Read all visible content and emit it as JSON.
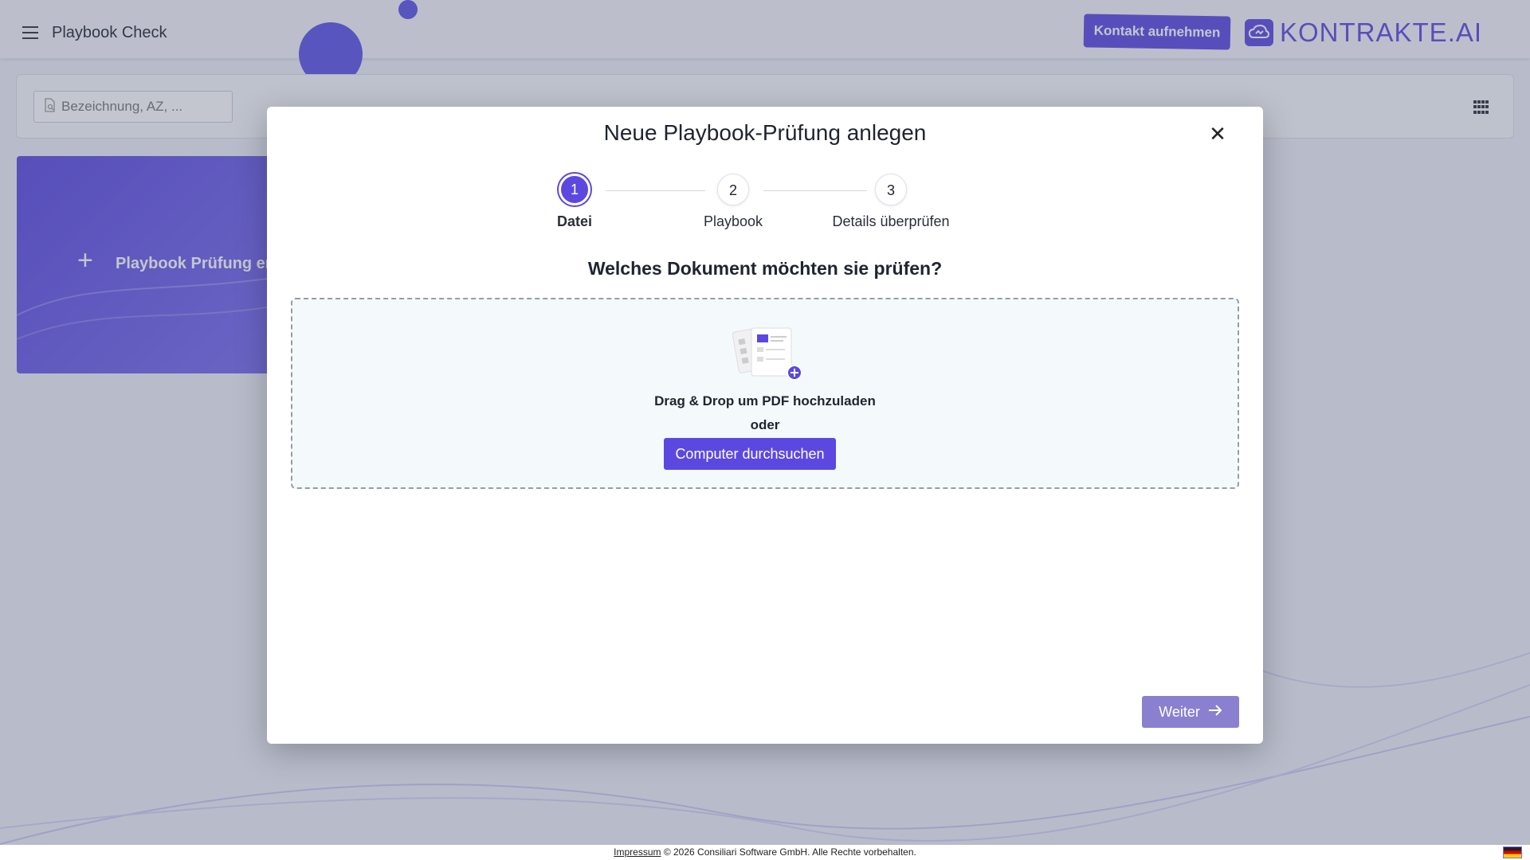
{
  "header": {
    "title": "Playbook Check",
    "contact_label": "Kontakt aufnehmen",
    "logo_text": "KONTRAKTE.AI"
  },
  "search": {
    "placeholder": "Bezeichnung, AZ, ..."
  },
  "create_card": {
    "label": "Playbook Prüfung ers"
  },
  "modal": {
    "title": "Neue Playbook-Prüfung anlegen",
    "steps": [
      {
        "number": "1",
        "label": "Datei",
        "active": true
      },
      {
        "number": "2",
        "label": "Playbook",
        "active": false
      },
      {
        "number": "3",
        "label": "Details überprüfen",
        "active": false
      }
    ],
    "question": "Welches Dokument möchten sie prüfen?",
    "dropzone": {
      "instruction": "Drag & Drop um PDF hochzuladen",
      "or_text": "oder",
      "browse_label": "Computer durchsuchen"
    },
    "next_label": "Weiter"
  },
  "footer": {
    "impressum_label": "Impressum",
    "copyright": " © 2026 Consiliari Software GmbH. Alle Rechte vorbehalten."
  },
  "colors": {
    "accent": "#5b48e0",
    "next_button": "#8a80cf"
  }
}
